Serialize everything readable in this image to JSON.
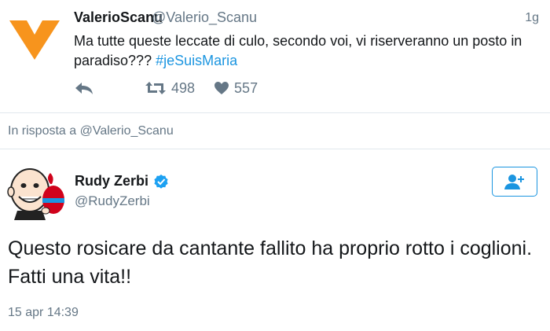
{
  "parent_tweet": {
    "author_name": "ValerioScanu",
    "author_handle": "@Valerio_Scanu",
    "time": "1g",
    "text": "Ma tutte queste leccate di culo, secondo voi, vi riserveranno un posto in paradiso??? ",
    "hashtag": "#jeSuisMaria",
    "retweet_count": "498",
    "like_count": "557",
    "avatar_icon": "orange-v-logo-icon",
    "accent_color": "#f7941d"
  },
  "reply_context": {
    "text": "In risposta a @Valerio_Scanu"
  },
  "main_tweet": {
    "author_name": "Rudy Zerbi",
    "author_handle": "@RudyZerbi",
    "verified": true,
    "text": "Questo rosicare da cantante fallito ha proprio rotto i coglioni. Fatti una vita!!",
    "timestamp": "15 apr 14:39",
    "follow_icon": "add-user-icon"
  },
  "colors": {
    "link": "#1b95e0",
    "secondary_text": "#657786",
    "divider": "#e1e8ed"
  }
}
